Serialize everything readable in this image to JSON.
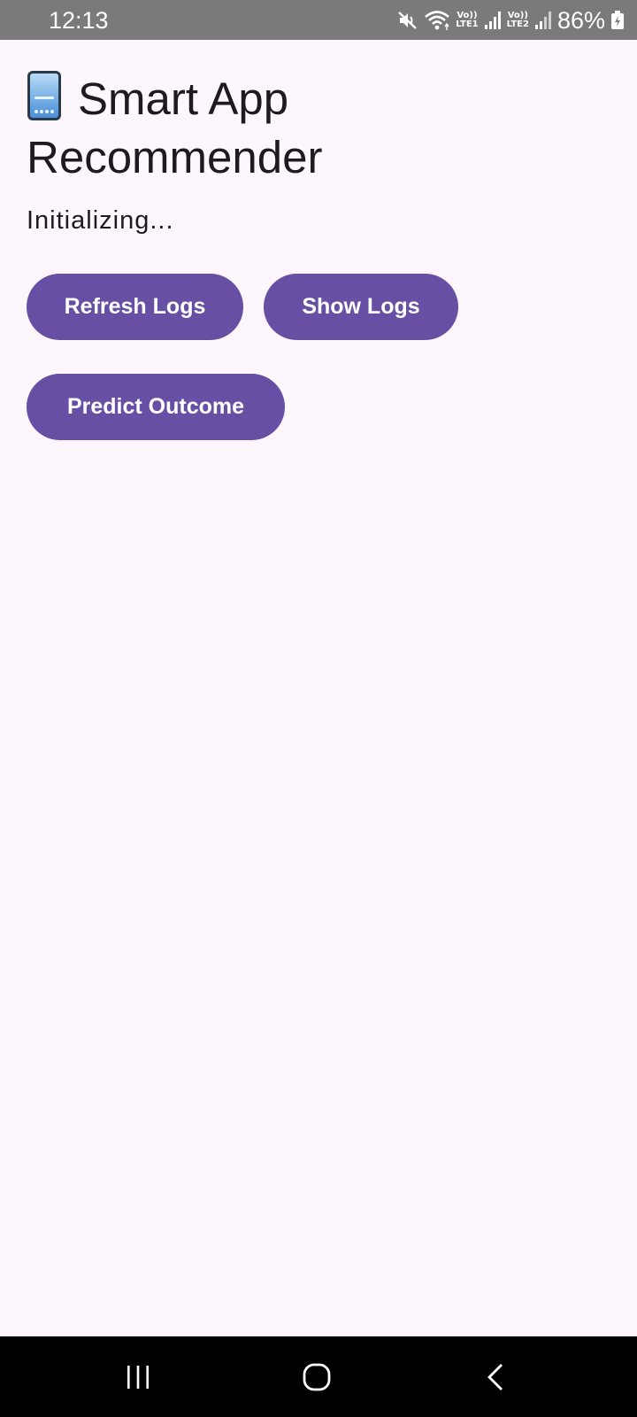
{
  "status_bar": {
    "time": "12:13",
    "network1": {
      "top": "Vo))",
      "bottom": "LTE1"
    },
    "network2": {
      "top": "Vo))",
      "bottom": "LTE2"
    },
    "battery": "86%",
    "icons": [
      "mute-icon",
      "wifi-icon",
      "signal-icon",
      "signal-icon",
      "battery-charging-icon"
    ]
  },
  "app": {
    "title": "Smart App Recommender",
    "title_icon": "mobile-phone-icon",
    "status_text": "Initializing...",
    "buttons": {
      "refresh": "Refresh Logs",
      "show": "Show Logs",
      "predict": "Predict Outcome"
    }
  },
  "nav_bar": {
    "icons": [
      "recents-icon",
      "home-icon",
      "back-icon"
    ]
  },
  "colors": {
    "background": "#fdf7fd",
    "button": "#6750a4",
    "status_bar": "#7a7a7a",
    "nav_bar": "#000000"
  }
}
